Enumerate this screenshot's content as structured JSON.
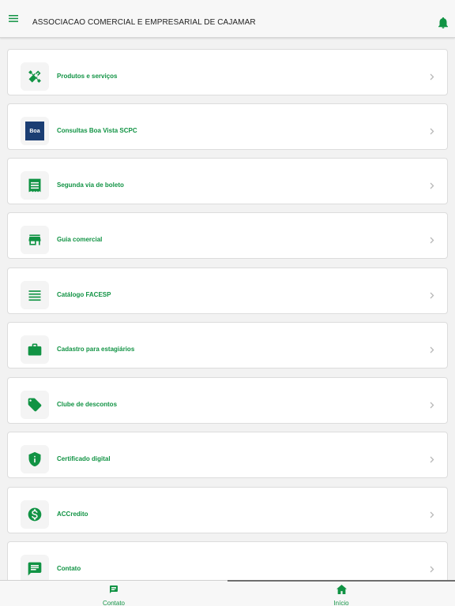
{
  "header": {
    "title": "ASSOCIACAO COMERCIAL E EMPRESARIAL DE CAJAMAR",
    "menu_icon": "hamburger-icon",
    "notification_icon": "bell-icon"
  },
  "colors": {
    "accent": "#119344",
    "boa_vista_bg": "#1b3e73"
  },
  "menu_items": [
    {
      "label": "Produtos e serviços",
      "icon": "tools-icon"
    },
    {
      "label": "Consultas Boa Vista SCPC",
      "icon": "boa-vista-logo",
      "logo_text": "Boa"
    },
    {
      "label": "Segunda via de boleto",
      "icon": "receipt-icon"
    },
    {
      "label": "Guia comercial",
      "icon": "store-icon"
    },
    {
      "label": "Catálogo FACESP",
      "icon": "list-icon"
    },
    {
      "label": "Cadastro para estagiários",
      "icon": "briefcase-icon"
    },
    {
      "label": "Clube de descontos",
      "icon": "tag-icon"
    },
    {
      "label": "Certificado digital",
      "icon": "shield-info-icon"
    },
    {
      "label": "ACCredito",
      "icon": "dollar-circle-icon"
    },
    {
      "label": "Contato",
      "icon": "chat-icon"
    }
  ],
  "bottom_nav": {
    "tabs": [
      {
        "label": "Contato",
        "icon": "chat-icon",
        "active": false
      },
      {
        "label": "Início",
        "icon": "home-icon",
        "active": true
      }
    ]
  }
}
